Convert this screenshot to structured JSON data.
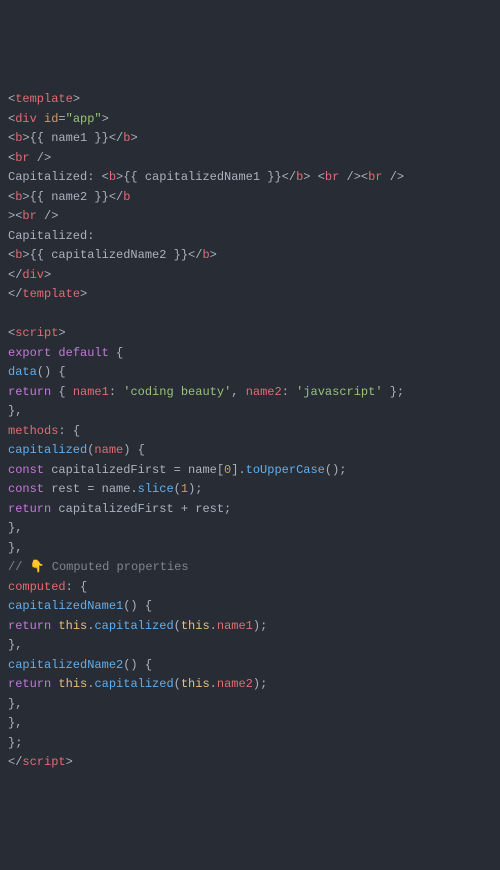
{
  "code": {
    "lines": [
      {
        "tokens": [
          {
            "t": "<",
            "c": "tag"
          },
          {
            "t": "template",
            "c": "tagname"
          },
          {
            "t": ">",
            "c": "tag"
          }
        ]
      },
      {
        "tokens": [
          {
            "t": "<",
            "c": "tag"
          },
          {
            "t": "div",
            "c": "tagname"
          },
          {
            "t": " ",
            "c": "tag"
          },
          {
            "t": "id",
            "c": "attrname"
          },
          {
            "t": "=",
            "c": "tag"
          },
          {
            "t": "\"app\"",
            "c": "string"
          },
          {
            "t": ">",
            "c": "tag"
          }
        ]
      },
      {
        "tokens": [
          {
            "t": "<",
            "c": "tag"
          },
          {
            "t": "b",
            "c": "tagname"
          },
          {
            "t": ">",
            "c": "tag"
          },
          {
            "t": "{{ name1 }}",
            "c": "punct"
          },
          {
            "t": "</",
            "c": "tag"
          },
          {
            "t": "b",
            "c": "tagname"
          },
          {
            "t": ">",
            "c": "tag"
          }
        ]
      },
      {
        "tokens": [
          {
            "t": "<",
            "c": "tag"
          },
          {
            "t": "br",
            "c": "tagname"
          },
          {
            "t": " />",
            "c": "tag"
          }
        ]
      },
      {
        "tokens": [
          {
            "t": "Capitalized: ",
            "c": "punct"
          },
          {
            "t": "<",
            "c": "tag"
          },
          {
            "t": "b",
            "c": "tagname"
          },
          {
            "t": ">",
            "c": "tag"
          },
          {
            "t": "{{ capitalizedName1 }}",
            "c": "punct"
          },
          {
            "t": "</",
            "c": "tag"
          },
          {
            "t": "b",
            "c": "tagname"
          },
          {
            "t": ">",
            "c": "tag"
          },
          {
            "t": " ",
            "c": "tag"
          },
          {
            "t": "<",
            "c": "tag"
          },
          {
            "t": "br",
            "c": "tagname"
          },
          {
            "t": " />",
            "c": "tag"
          },
          {
            "t": "<",
            "c": "tag"
          },
          {
            "t": "br",
            "c": "tagname"
          },
          {
            "t": " />",
            "c": "tag"
          }
        ]
      },
      {
        "tokens": [
          {
            "t": "<",
            "c": "tag"
          },
          {
            "t": "b",
            "c": "tagname"
          },
          {
            "t": ">",
            "c": "tag"
          },
          {
            "t": "{{ name2 }}",
            "c": "punct"
          },
          {
            "t": "</",
            "c": "tag"
          },
          {
            "t": "b",
            "c": "tagname"
          }
        ]
      },
      {
        "tokens": [
          {
            "t": ">",
            "c": "tag"
          },
          {
            "t": "<",
            "c": "tag"
          },
          {
            "t": "br",
            "c": "tagname"
          },
          {
            "t": " />",
            "c": "tag"
          }
        ]
      },
      {
        "tokens": [
          {
            "t": "Capitalized:",
            "c": "punct"
          }
        ]
      },
      {
        "tokens": [
          {
            "t": "<",
            "c": "tag"
          },
          {
            "t": "b",
            "c": "tagname"
          },
          {
            "t": ">",
            "c": "tag"
          },
          {
            "t": "{{ capitalizedName2 }}",
            "c": "punct"
          },
          {
            "t": "</",
            "c": "tag"
          },
          {
            "t": "b",
            "c": "tagname"
          },
          {
            "t": ">",
            "c": "tag"
          }
        ]
      },
      {
        "tokens": [
          {
            "t": "</",
            "c": "tag"
          },
          {
            "t": "div",
            "c": "tagname"
          },
          {
            "t": ">",
            "c": "tag"
          }
        ]
      },
      {
        "tokens": [
          {
            "t": "</",
            "c": "tag"
          },
          {
            "t": "template",
            "c": "tagname"
          },
          {
            "t": ">",
            "c": "tag"
          }
        ]
      },
      {
        "tokens": [
          {
            "t": "",
            "c": "punct"
          }
        ]
      },
      {
        "tokens": [
          {
            "t": "<",
            "c": "tag"
          },
          {
            "t": "script",
            "c": "tagname"
          },
          {
            "t": ">",
            "c": "tag"
          }
        ]
      },
      {
        "tokens": [
          {
            "t": "export",
            "c": "keyword"
          },
          {
            "t": " ",
            "c": "punct"
          },
          {
            "t": "default",
            "c": "keyword"
          },
          {
            "t": " {",
            "c": "punct"
          }
        ]
      },
      {
        "tokens": [
          {
            "t": "data",
            "c": "func"
          },
          {
            "t": "() {",
            "c": "punct"
          }
        ]
      },
      {
        "tokens": [
          {
            "t": "return",
            "c": "keyword"
          },
          {
            "t": " { ",
            "c": "punct"
          },
          {
            "t": "name1",
            "c": "prop"
          },
          {
            "t": ": ",
            "c": "punct"
          },
          {
            "t": "'coding beauty'",
            "c": "string"
          },
          {
            "t": ", ",
            "c": "punct"
          },
          {
            "t": "name2",
            "c": "prop"
          },
          {
            "t": ": ",
            "c": "punct"
          },
          {
            "t": "'javascript'",
            "c": "string"
          },
          {
            "t": " };",
            "c": "punct"
          }
        ]
      },
      {
        "tokens": [
          {
            "t": "},",
            "c": "punct"
          }
        ]
      },
      {
        "tokens": [
          {
            "t": "methods",
            "c": "prop"
          },
          {
            "t": ": {",
            "c": "punct"
          }
        ]
      },
      {
        "tokens": [
          {
            "t": "capitalized",
            "c": "func"
          },
          {
            "t": "(",
            "c": "punct"
          },
          {
            "t": "name",
            "c": "prop"
          },
          {
            "t": ") {",
            "c": "punct"
          }
        ]
      },
      {
        "tokens": [
          {
            "t": "const",
            "c": "keyword"
          },
          {
            "t": " capitalizedFirst = name[",
            "c": "punct"
          },
          {
            "t": "0",
            "c": "number"
          },
          {
            "t": "].",
            "c": "punct"
          },
          {
            "t": "toUpperCase",
            "c": "func"
          },
          {
            "t": "();",
            "c": "punct"
          }
        ]
      },
      {
        "tokens": [
          {
            "t": "const",
            "c": "keyword"
          },
          {
            "t": " rest = name.",
            "c": "punct"
          },
          {
            "t": "slice",
            "c": "func"
          },
          {
            "t": "(",
            "c": "punct"
          },
          {
            "t": "1",
            "c": "number"
          },
          {
            "t": ");",
            "c": "punct"
          }
        ]
      },
      {
        "tokens": [
          {
            "t": "return",
            "c": "keyword"
          },
          {
            "t": " capitalizedFirst + rest;",
            "c": "punct"
          }
        ]
      },
      {
        "tokens": [
          {
            "t": "},",
            "c": "punct"
          }
        ]
      },
      {
        "tokens": [
          {
            "t": "},",
            "c": "punct"
          }
        ]
      },
      {
        "tokens": [
          {
            "t": "// 👇 Computed properties",
            "c": "comment"
          }
        ]
      },
      {
        "tokens": [
          {
            "t": "computed",
            "c": "prop"
          },
          {
            "t": ": {",
            "c": "punct"
          }
        ]
      },
      {
        "tokens": [
          {
            "t": "capitalizedName1",
            "c": "func"
          },
          {
            "t": "() {",
            "c": "punct"
          }
        ]
      },
      {
        "tokens": [
          {
            "t": "return",
            "c": "keyword"
          },
          {
            "t": " ",
            "c": "punct"
          },
          {
            "t": "this",
            "c": "this"
          },
          {
            "t": ".",
            "c": "punct"
          },
          {
            "t": "capitalized",
            "c": "func"
          },
          {
            "t": "(",
            "c": "punct"
          },
          {
            "t": "this",
            "c": "this"
          },
          {
            "t": ".",
            "c": "punct"
          },
          {
            "t": "name1",
            "c": "prop"
          },
          {
            "t": ");",
            "c": "punct"
          }
        ]
      },
      {
        "tokens": [
          {
            "t": "},",
            "c": "punct"
          }
        ]
      },
      {
        "tokens": [
          {
            "t": "capitalizedName2",
            "c": "func"
          },
          {
            "t": "() {",
            "c": "punct"
          }
        ]
      },
      {
        "tokens": [
          {
            "t": "return",
            "c": "keyword"
          },
          {
            "t": " ",
            "c": "punct"
          },
          {
            "t": "this",
            "c": "this"
          },
          {
            "t": ".",
            "c": "punct"
          },
          {
            "t": "capitalized",
            "c": "func"
          },
          {
            "t": "(",
            "c": "punct"
          },
          {
            "t": "this",
            "c": "this"
          },
          {
            "t": ".",
            "c": "punct"
          },
          {
            "t": "name2",
            "c": "prop"
          },
          {
            "t": ");",
            "c": "punct"
          }
        ]
      },
      {
        "tokens": [
          {
            "t": "},",
            "c": "punct"
          }
        ]
      },
      {
        "tokens": [
          {
            "t": "},",
            "c": "punct"
          }
        ]
      },
      {
        "tokens": [
          {
            "t": "};",
            "c": "punct"
          }
        ]
      },
      {
        "tokens": [
          {
            "t": "</",
            "c": "tag"
          },
          {
            "t": "script",
            "c": "tagname"
          },
          {
            "t": ">",
            "c": "tag"
          }
        ]
      }
    ]
  }
}
